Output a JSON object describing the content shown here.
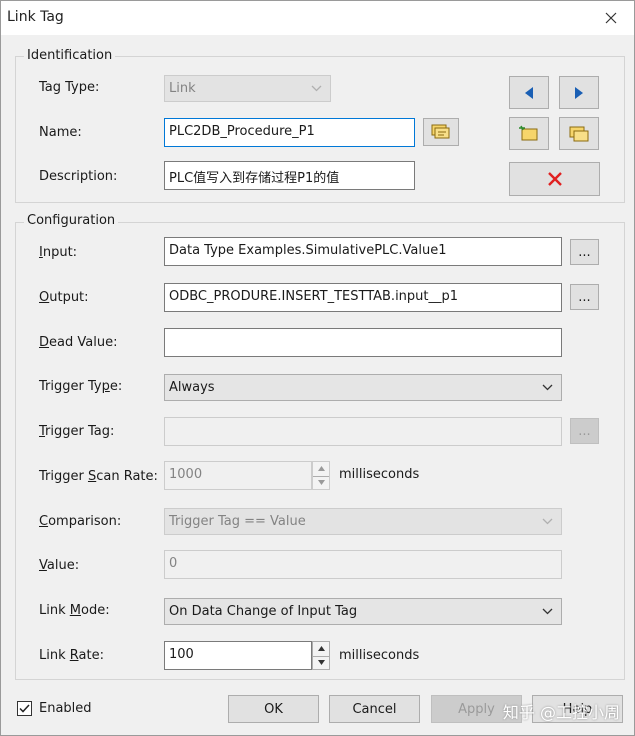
{
  "window": {
    "title": "Link Tag"
  },
  "identification": {
    "group_label": "Identification",
    "tag_type_label": "Tag Type:",
    "tag_type_value": "Link",
    "name_label": "Name:",
    "name_value": "PLC2DB_Procedure_P1",
    "description_label": "Description:",
    "description_value": "PLC值写入到存储过程P1的值"
  },
  "configuration": {
    "group_label": "Configuration",
    "input_label": "Input:",
    "input_value": "Data Type Examples.SimulativePLC.Value1",
    "output_label": "Output:",
    "output_value": "ODBC_PRODURE.INSERT_TESTTAB.input__p1",
    "dead_value_label": "Dead Value:",
    "dead_value_value": "",
    "trigger_type_label": "Trigger Type:",
    "trigger_type_value": "Always",
    "trigger_tag_label": "Trigger Tag:",
    "trigger_tag_value": "",
    "trigger_scan_rate_label": "Trigger Scan Rate:",
    "trigger_scan_rate_value": "1000",
    "trigger_scan_rate_unit": "milliseconds",
    "comparison_label": "Comparison:",
    "comparison_value": "Trigger Tag == Value",
    "value_label": "Value:",
    "value_value": "0",
    "link_mode_label": "Link Mode:",
    "link_mode_value": "On Data Change of Input Tag",
    "link_rate_label": "Link Rate:",
    "link_rate_value": "100",
    "link_rate_unit": "milliseconds",
    "browse_label": "..."
  },
  "footer": {
    "enabled_label": "Enabled",
    "enabled_checked": true,
    "ok_label": "OK",
    "cancel_label": "Cancel",
    "apply_label": "Apply",
    "help_label": "Help"
  },
  "watermark": "知乎 @工控小周",
  "icons": {
    "close": "close-icon",
    "prev": "triangle-left-icon",
    "next": "triangle-right-icon",
    "delete": "red-x-icon",
    "tag_browser": "tag-browser-icon",
    "new_tag": "new-tag-icon",
    "duplicate_tag": "duplicate-tag-icon"
  },
  "colors": {
    "focus_border": "#0078d7",
    "nav_arrow": "#1a5fb4",
    "delete_x": "#e02020"
  }
}
